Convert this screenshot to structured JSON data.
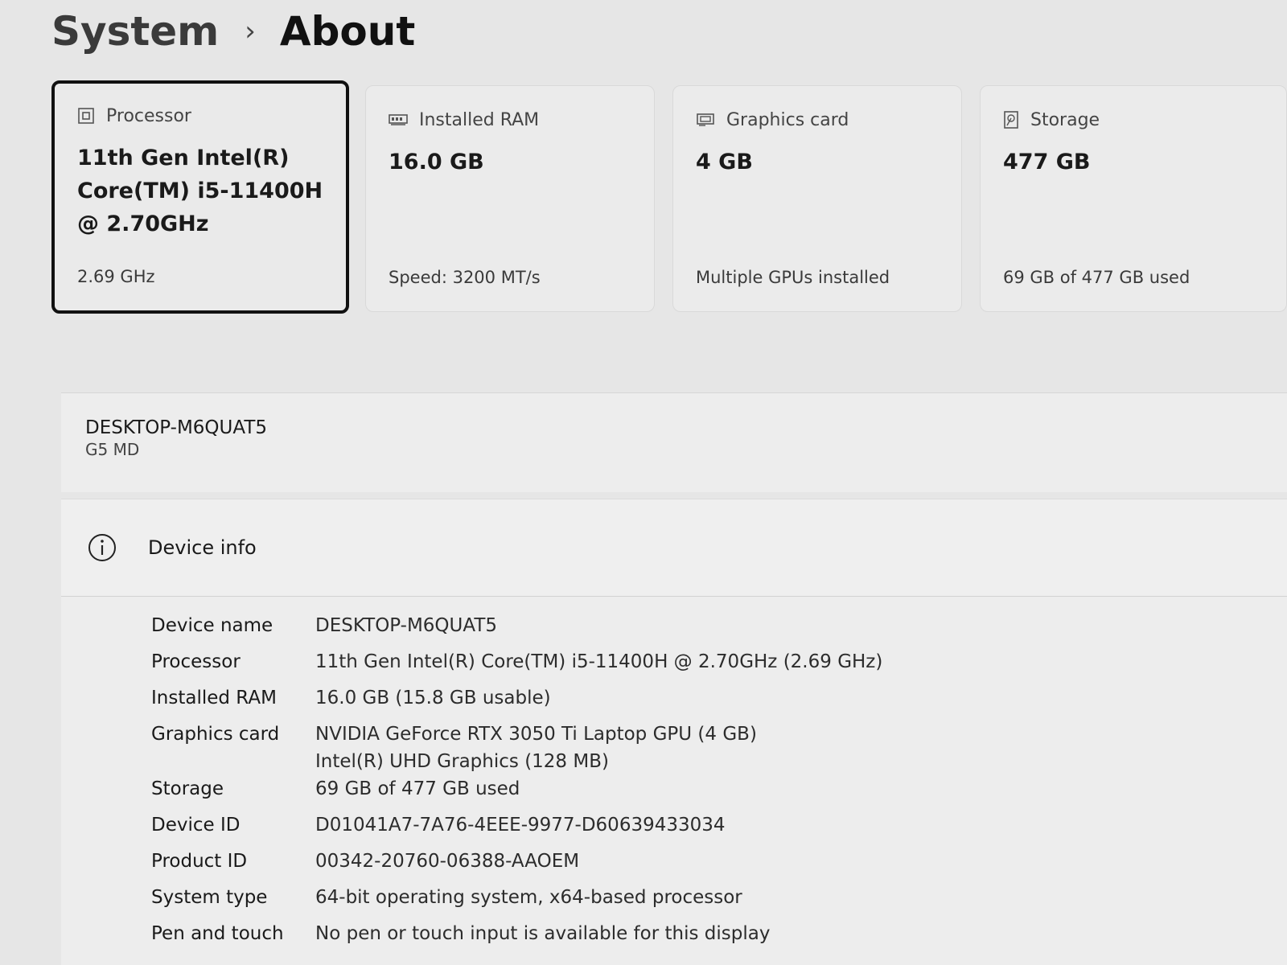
{
  "breadcrumb": {
    "parent": "System",
    "separator": "›",
    "current": "About"
  },
  "cards": [
    {
      "label": "Processor",
      "icon": "processor-icon",
      "value": "11th Gen Intel(R) Core(TM) i5-11400H @ 2.70GHz",
      "sub": "2.69 GHz"
    },
    {
      "label": "Installed RAM",
      "icon": "ram-icon",
      "value": "16.0 GB",
      "sub": "Speed: 3200 MT/s"
    },
    {
      "label": "Graphics card",
      "icon": "graphics-card-icon",
      "value": "4 GB",
      "sub": "Multiple GPUs installed"
    },
    {
      "label": "Storage",
      "icon": "storage-icon",
      "value": "477 GB",
      "sub": "69 GB of 477 GB used"
    }
  ],
  "host": {
    "name": "DESKTOP-M6QUAT5",
    "model": "G5 MD"
  },
  "device_info": {
    "title": "Device info",
    "icon": "info-icon",
    "specs": [
      {
        "label": "Device name",
        "value": "DESKTOP-M6QUAT5"
      },
      {
        "label": "Processor",
        "value": "11th Gen Intel(R) Core(TM) i5-11400H @ 2.70GHz (2.69 GHz)"
      },
      {
        "label": "Installed RAM",
        "value": "16.0 GB (15.8 GB usable)"
      },
      {
        "label": "Graphics card",
        "value": "NVIDIA GeForce RTX 3050 Ti Laptop GPU (4 GB)",
        "value2": "Intel(R) UHD Graphics (128 MB)"
      },
      {
        "label": "Storage",
        "value": "69 GB of 477 GB used"
      },
      {
        "label": "Device ID",
        "value": "D01041A7-7A76-4EEE-9977-D60639433034"
      },
      {
        "label": "Product ID",
        "value": "00342-20760-06388-AAOEM"
      },
      {
        "label": "System type",
        "value": "64-bit operating system, x64-based processor"
      },
      {
        "label": "Pen and touch",
        "value": "No pen or touch input is available for this display"
      }
    ]
  }
}
